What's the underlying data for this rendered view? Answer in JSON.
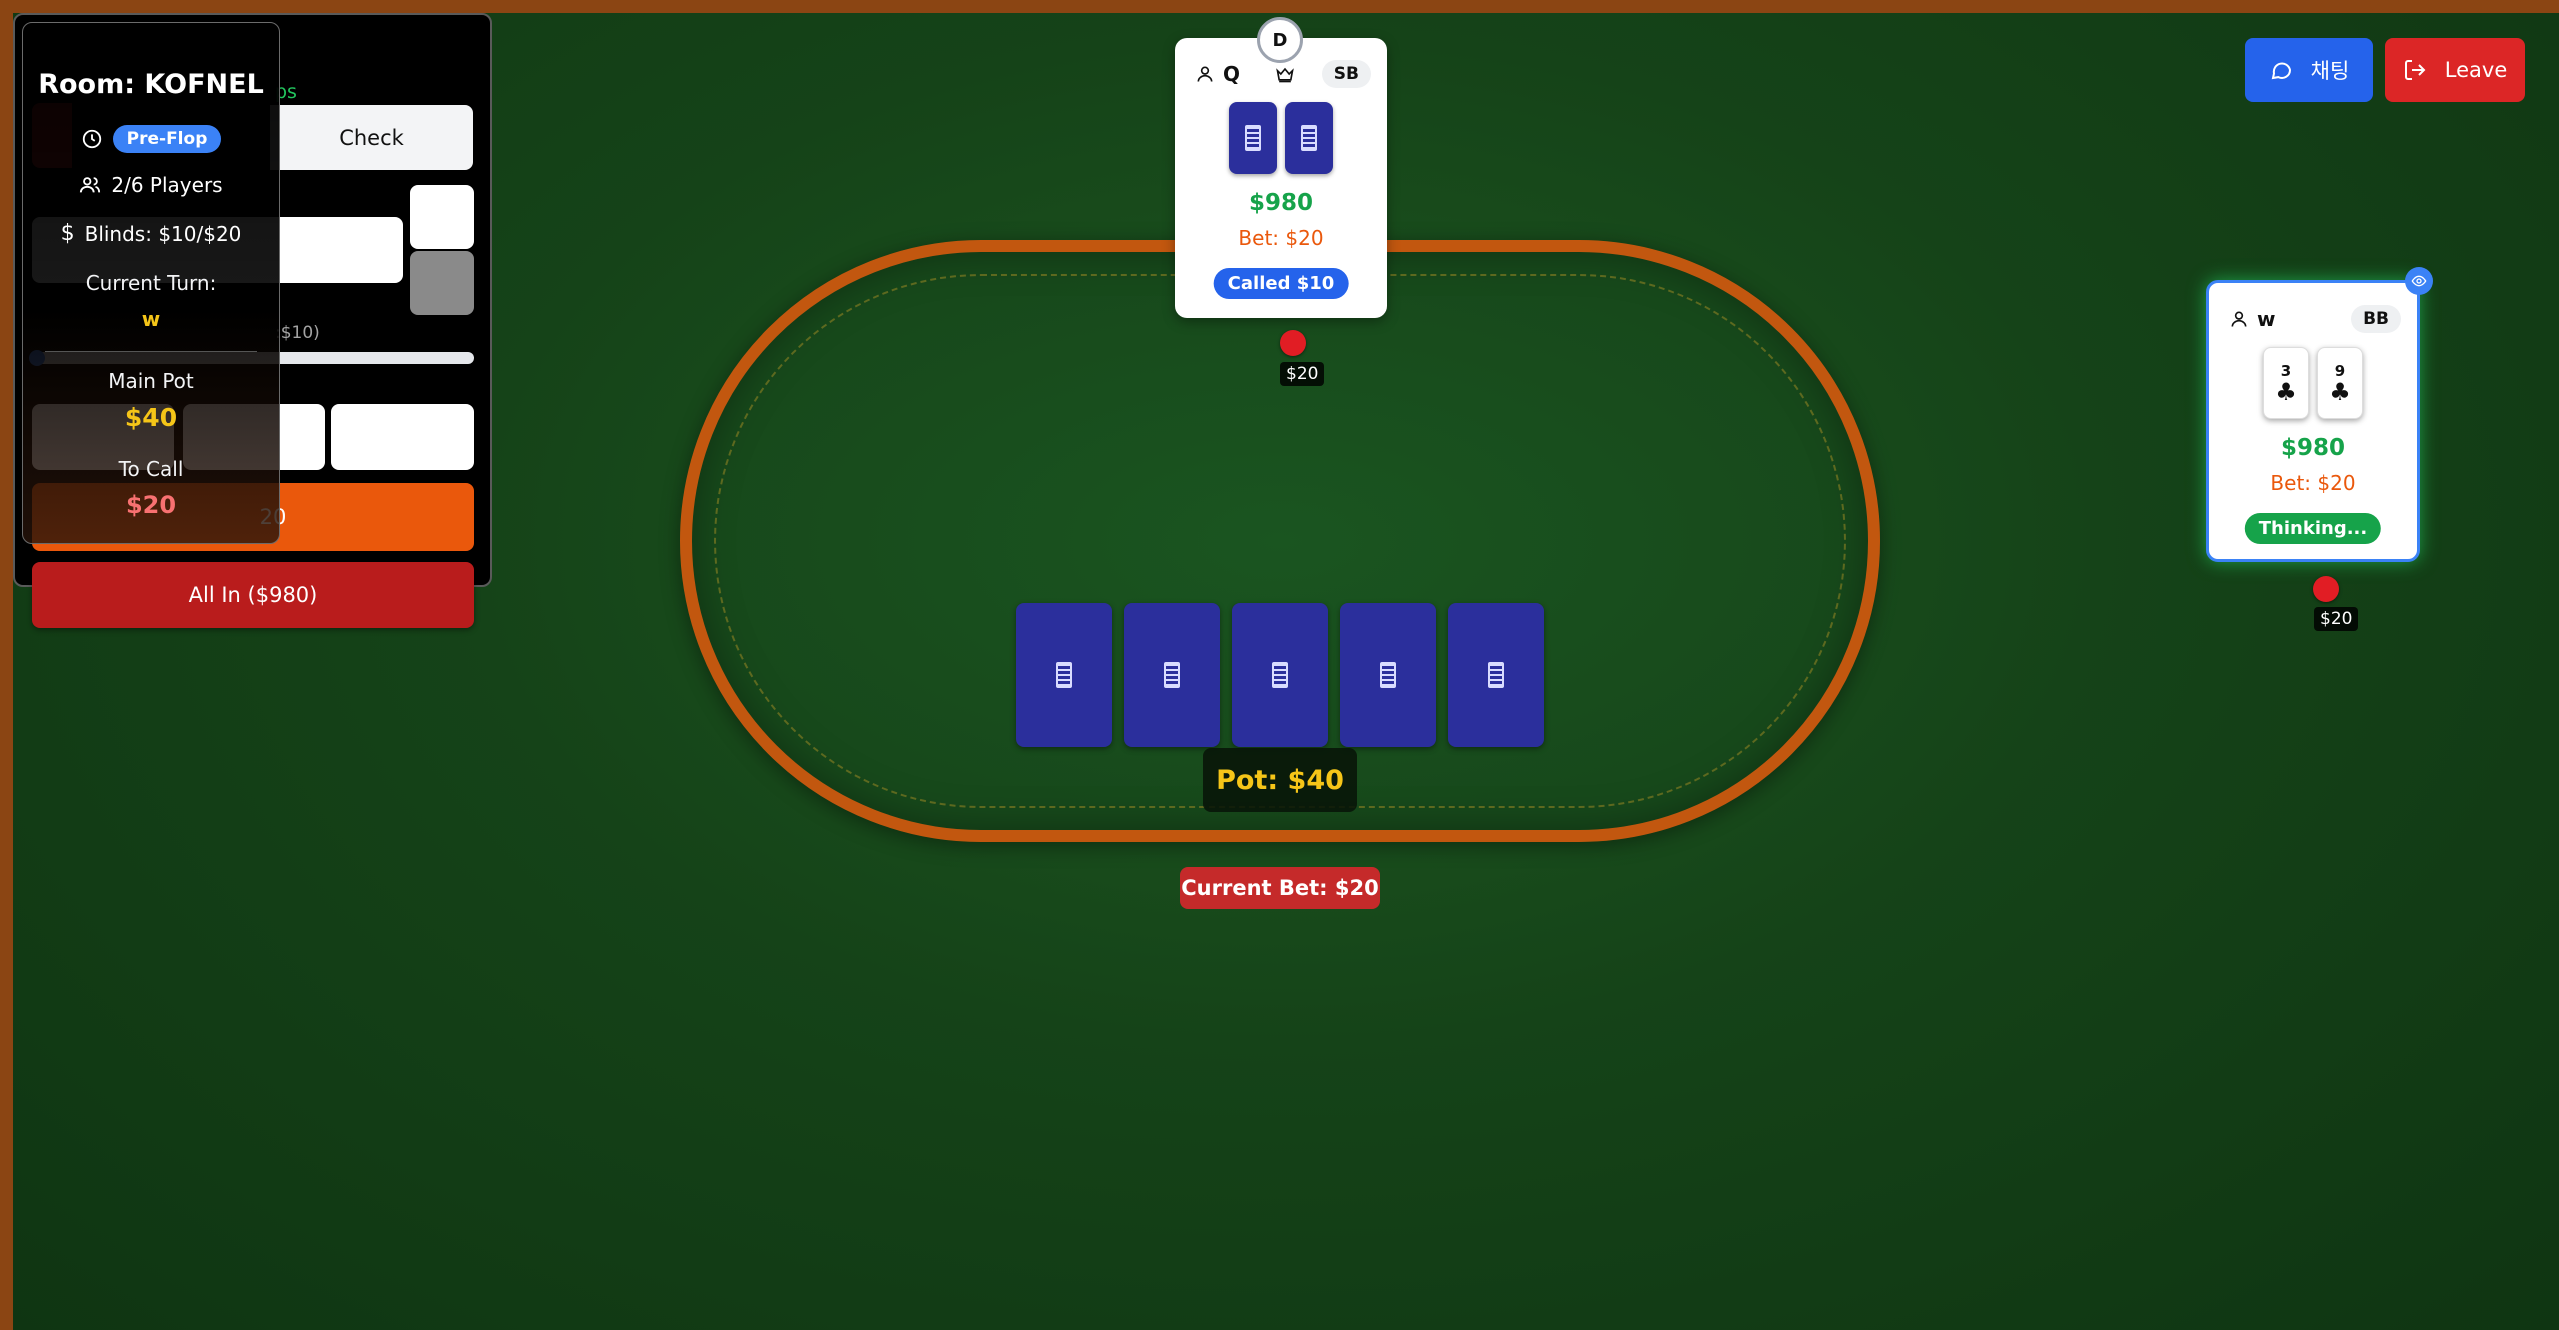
{
  "room": {
    "title": "Room: KOFNEL",
    "phase": "Pre-Flop",
    "players": "2/6 Players",
    "blinds": "Blinds: $10/$20",
    "current_turn_label": "Current Turn:",
    "current_turn_value": "w",
    "main_pot_label": "Main Pot",
    "main_pot_value": "$40",
    "to_call_label": "To Call",
    "to_call_value": "$20"
  },
  "actions": {
    "chips_label": "ps",
    "check_label": "Check",
    "min_label": ":$10)",
    "raise_label": "20",
    "allin_label": "All In ($980)"
  },
  "header": {
    "chat_label": "채팅",
    "leave_label": "Leave"
  },
  "table": {
    "pot": "Pot: $40",
    "current_bet": "Current Bet: $20",
    "community_cards": [
      "face-down",
      "face-down",
      "face-down",
      "face-down",
      "face-down"
    ]
  },
  "dealer_button": "D",
  "players": [
    {
      "name": "Q",
      "position": "SB",
      "is_host": true,
      "chips": "$980",
      "bet": "Bet: $20",
      "status": "Called $10",
      "status_color": "#2563eb",
      "bet_chip_amount": "$20",
      "cards": [
        "face-down",
        "face-down"
      ]
    },
    {
      "name": "w",
      "position": "BB",
      "chips": "$980",
      "bet": "Bet: $20",
      "status": "Thinking...",
      "status_color": "#16a34a",
      "bet_chip_amount": "$20",
      "cards": [
        {
          "rank": "3",
          "suit": "♣"
        },
        {
          "rank": "9",
          "suit": "♣"
        }
      ]
    }
  ],
  "colors": {
    "felt": "#17491b",
    "rail": "#c2570f",
    "card_back": "#2b2f9c",
    "pot_text": "#f5c518",
    "chip": "#e11d24"
  }
}
